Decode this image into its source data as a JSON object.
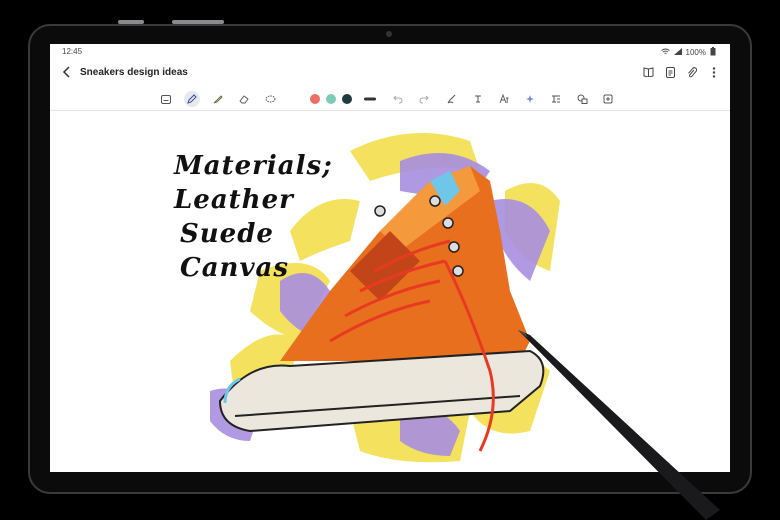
{
  "status_bar": {
    "time": "12:45",
    "battery": "100%"
  },
  "app_bar": {
    "title": "Sneakers design ideas"
  },
  "toolbar": {
    "colors": [
      "#ec6e67",
      "#7dcab8",
      "#1f3a3c"
    ],
    "icons": [
      "text-mode-icon",
      "pen-icon",
      "highlighter-icon",
      "eraser-icon",
      "lasso-icon",
      "color-red",
      "color-mint",
      "color-dark",
      "stroke-width-icon",
      "undo-icon",
      "redo-icon",
      "handwriting-icon",
      "text-style-icon",
      "ai-text-icon",
      "shapes-icon",
      "convert-text-icon",
      "insert-icon",
      "more-tools-icon"
    ]
  },
  "handwritten_text": {
    "line1": "Materials;",
    "line2": "Leather",
    "line3": "Suede",
    "line4": "Canvas"
  }
}
